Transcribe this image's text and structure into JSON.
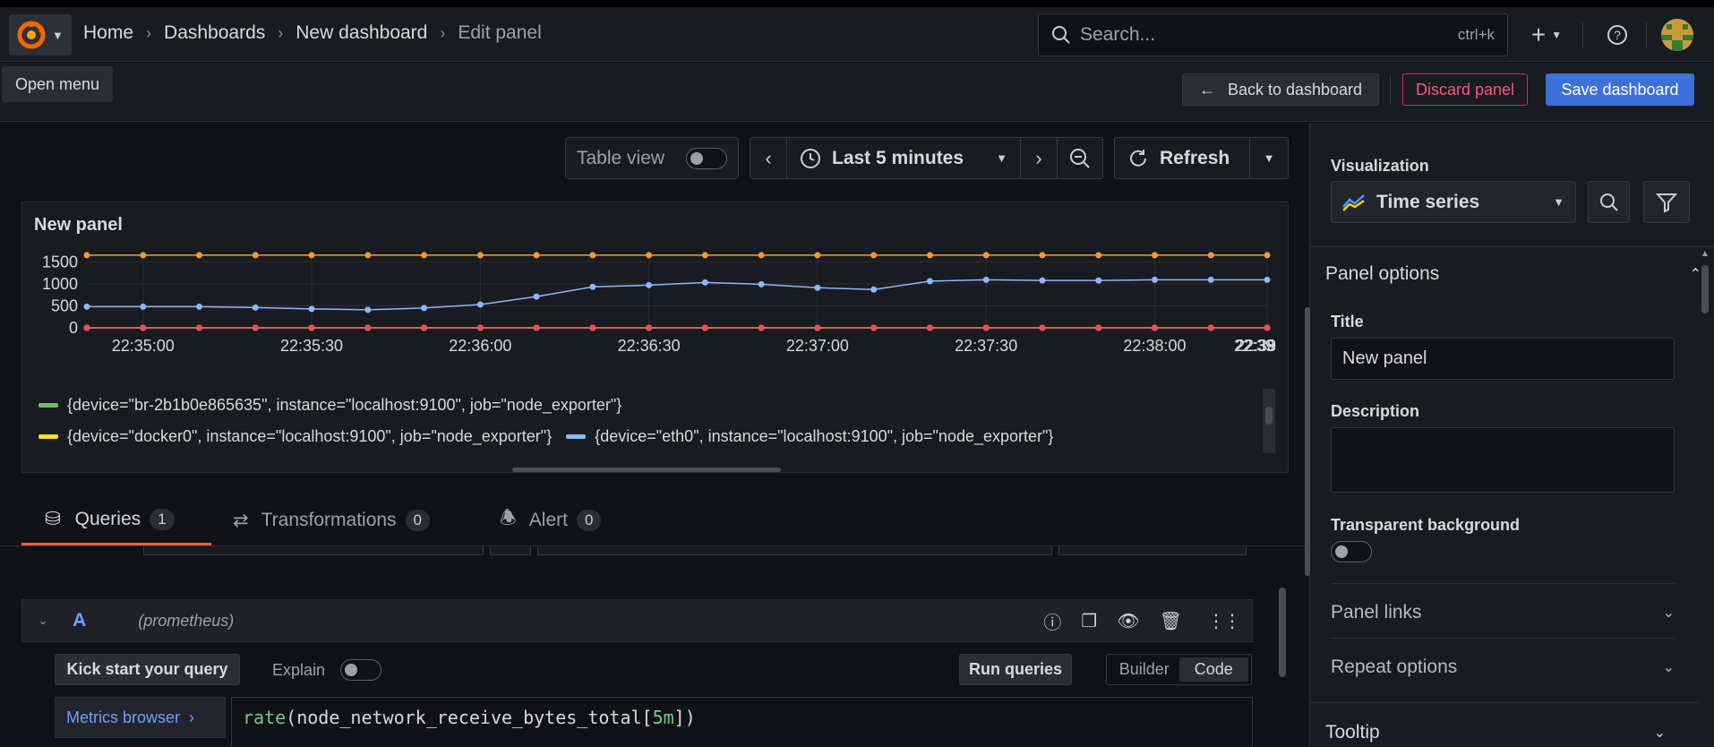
{
  "topbar": {
    "breadcrumbs": [
      "Home",
      "Dashboards",
      "New dashboard",
      "Edit panel"
    ],
    "search_placeholder": "Search...",
    "search_shortcut": "ctrl+k",
    "tooltip": "Open menu"
  },
  "actions": {
    "back": "Back to dashboard",
    "discard": "Discard panel",
    "save": "Save dashboard"
  },
  "controls": {
    "table_view": "Table view",
    "time_range": "Last 5 minutes",
    "refresh": "Refresh"
  },
  "panel": {
    "title": "New panel"
  },
  "chart_data": {
    "type": "line",
    "title": "New panel",
    "x": [
      "22:34:50",
      "22:35:00",
      "22:35:10",
      "22:35:20",
      "22:35:30",
      "22:35:40",
      "22:35:50",
      "22:36:00",
      "22:36:10",
      "22:36:20",
      "22:36:30",
      "22:36:40",
      "22:36:50",
      "22:37:00",
      "22:37:10",
      "22:37:20",
      "22:37:30",
      "22:37:40",
      "22:37:50",
      "22:38:00",
      "22:38:10",
      "22:38:20"
    ],
    "x_tick_labels": [
      "22:35:00",
      "22:35:30",
      "22:36:00",
      "22:36:30",
      "22:37:00",
      "22:37:30",
      "22:38:00",
      "22:38:30",
      "22:39:00",
      "22:39"
    ],
    "y_ticks": [
      0,
      500,
      1000,
      1500
    ],
    "ylim": [
      0,
      1750
    ],
    "grid": true,
    "legend_position": "bottom",
    "series": [
      {
        "name": "{device=\"br-2b1b0e865635\", instance=\"localhost:9100\", job=\"node_exporter\"}",
        "color": "#73bf69",
        "values": [
          0,
          0,
          0,
          0,
          0,
          0,
          0,
          0,
          0,
          0,
          0,
          0,
          0,
          0,
          0,
          0,
          0,
          0,
          0,
          0,
          0,
          0
        ]
      },
      {
        "name": "{device=\"docker0\", instance=\"localhost:9100\", job=\"node_exporter\"}",
        "color": "#fade2a",
        "values": [
          0,
          0,
          0,
          0,
          0,
          0,
          0,
          0,
          0,
          0,
          0,
          0,
          0,
          0,
          0,
          0,
          0,
          0,
          0,
          0,
          0,
          0
        ]
      },
      {
        "name": "{device=\"eth0\", instance=\"localhost:9100\", job=\"node_exporter\"}",
        "color": "#8ab8ff",
        "values": [
          480,
          480,
          480,
          460,
          430,
          410,
          450,
          530,
          710,
          930,
          970,
          1030,
          990,
          910,
          870,
          1060,
          1090,
          1075,
          1075,
          1090,
          1090,
          1090
        ]
      },
      {
        "name": "",
        "color": "#ff9830",
        "values": [
          1650,
          1650,
          1650,
          1650,
          1650,
          1650,
          1650,
          1650,
          1650,
          1650,
          1650,
          1650,
          1650,
          1650,
          1650,
          1650,
          1650,
          1650,
          1650,
          1650,
          1650,
          1650
        ]
      },
      {
        "name": "",
        "color": "#f2495c",
        "values": [
          0,
          0,
          0,
          0,
          0,
          0,
          0,
          0,
          0,
          0,
          0,
          0,
          0,
          0,
          0,
          0,
          0,
          0,
          0,
          0,
          0,
          0
        ]
      }
    ]
  },
  "tabs": [
    {
      "label": "Queries",
      "count": "1"
    },
    {
      "label": "Transformations",
      "count": "0"
    },
    {
      "label": "Alert",
      "count": "0"
    }
  ],
  "query": {
    "ref": "A",
    "datasource": "(prometheus)",
    "kickstart": "Kick start your query",
    "explain": "Explain",
    "run": "Run queries",
    "builder": "Builder",
    "code": "Code",
    "metrics_browser": "Metrics browser",
    "expr_fn": "rate",
    "expr_open": "(",
    "expr_metric": "node_network_receive_bytes_total",
    "expr_lbr": "[",
    "expr_range": "5m",
    "expr_close": "])"
  },
  "options": {
    "visualization_label": "Visualization",
    "visualization": "Time series",
    "panel_options": "Panel options",
    "title_label": "Title",
    "title_value": "New panel",
    "description_label": "Description",
    "transparent_label": "Transparent background",
    "panel_links": "Panel links",
    "repeat_options": "Repeat options",
    "tooltip": "Tooltip"
  },
  "colors": {
    "accent": "#3d71d9",
    "danger": "#ff5286",
    "background": "#111217"
  }
}
